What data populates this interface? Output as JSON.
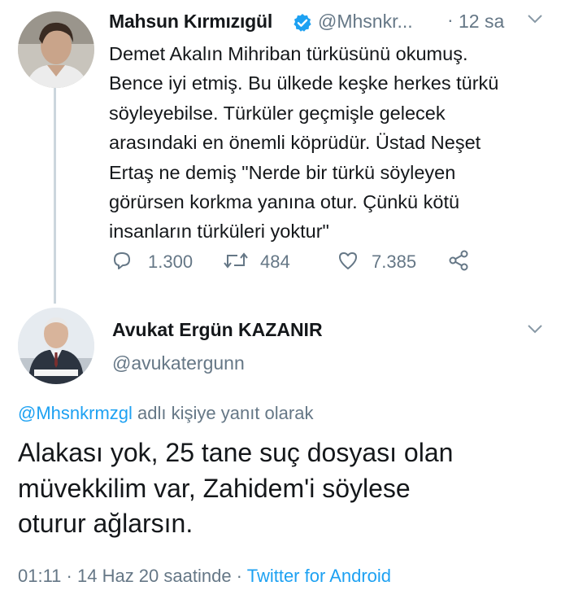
{
  "tweet": {
    "author_name": "Mahsun Kırmızıgül",
    "author_handle": "@Mhsnkr...",
    "separator": "·",
    "time": "12 sa",
    "body_lines": [
      "Demet Akalın Mihriban türküsünü okumuş.",
      "Bence iyi etmiş. Bu ülkede keşke herkes türkü",
      "söyleyebilse.  Türküler geçmişle gelecek",
      "arasındaki en önemli köprüdür. Üstad Neşet",
      "Ertaş ne demiş  \"Nerde bir türkü söyleyen",
      "görürsen korkma yanına otur. Çünkü kötü",
      "insanların türküleri yoktur\""
    ],
    "actions": {
      "reply_count": "1.300",
      "retweet_count": "484",
      "like_count": "7.385"
    }
  },
  "reply": {
    "author_name": "Avukat Ergün KAZANIR",
    "author_handle": "@avukatergunn",
    "replying_to_mention": "@Mhsnkrmzgl",
    "replying_to_suffix": " adlı kişiye yanıt olarak",
    "body_lines": [
      "Alakası yok, 25 tane suç dosyası olan",
      "müvekkilim var, Zahidem'i söylese",
      "oturur ağlarsın."
    ],
    "time": "01:11",
    "separator1": " · ",
    "date": "14 Haz 20 saatinde",
    "separator2": " · ",
    "source": "Twitter for Android"
  },
  "icons": {
    "verified": "verified-badge-icon",
    "chevron": "chevron-down-icon",
    "reply": "reply-icon",
    "retweet": "retweet-icon",
    "like": "heart-icon",
    "share": "share-icon"
  },
  "colors": {
    "accent": "#1da1f2",
    "muted": "#657786",
    "text": "#14171a",
    "thread_line": "#ccd6dd"
  }
}
